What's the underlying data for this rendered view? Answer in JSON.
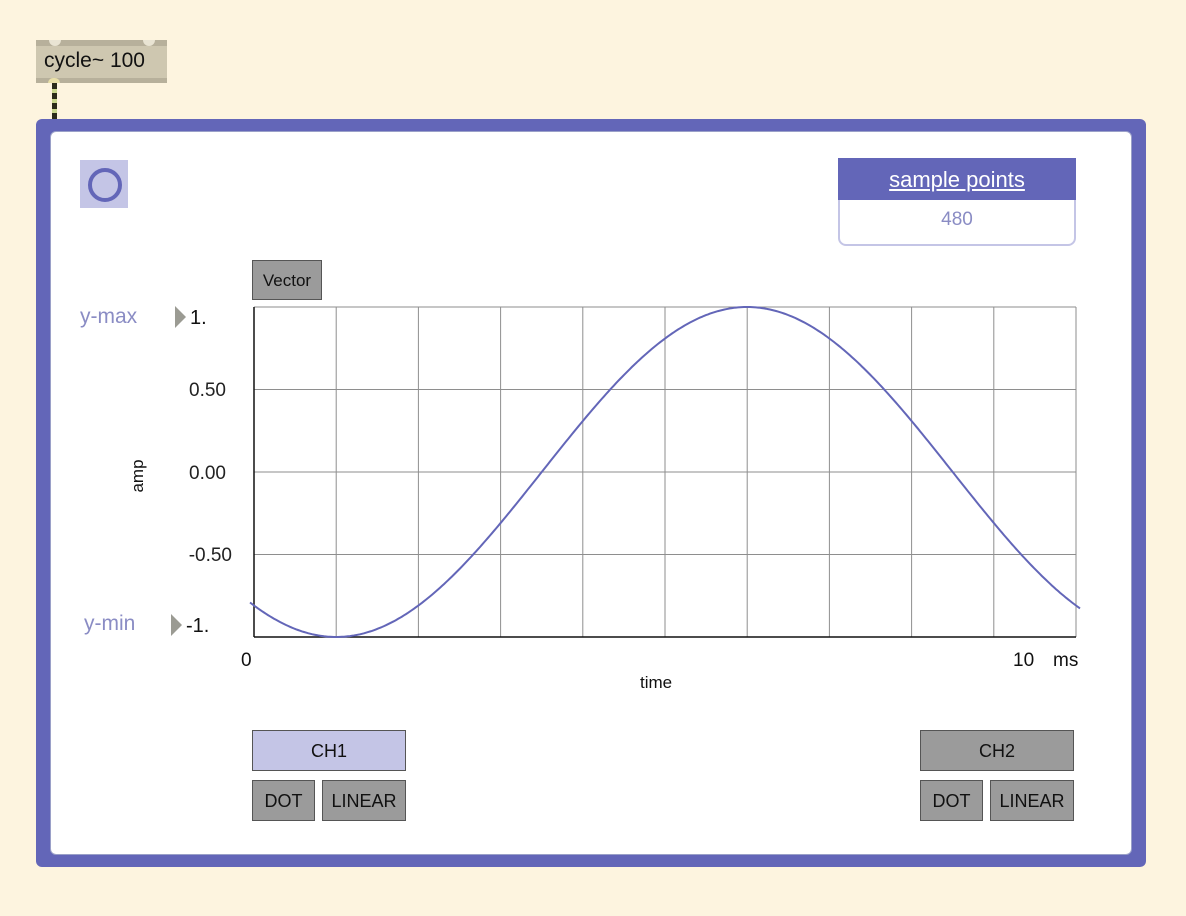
{
  "object": {
    "label": "cycle~ 100"
  },
  "toggle": {
    "icon": "circle-icon"
  },
  "sample_points": {
    "title": "sample points",
    "value": "480"
  },
  "scope": {
    "vector_label": "Vector",
    "y_max_label": "y-max",
    "y_max_value": "1.",
    "y_min_label": "y-min",
    "y_min_value": "-1.",
    "y_ticks": [
      "0.50",
      "0.00",
      "-0.50"
    ],
    "y_axis_label": "amp",
    "x_start": "0",
    "x_end": "10",
    "x_unit": "ms",
    "x_axis_label": "time",
    "curve_color": "#6366b8",
    "grid_color": "#8e8e8e"
  },
  "channels": {
    "ch1": {
      "label": "CH1",
      "dot": "DOT",
      "linear": "LINEAR",
      "active_color": "#c4c5e6"
    },
    "ch2": {
      "label": "CH2",
      "dot": "DOT",
      "linear": "LINEAR"
    }
  },
  "colors": {
    "accent": "#6366b8",
    "background": "#fdf4df",
    "button": "#9b9b9b"
  }
}
